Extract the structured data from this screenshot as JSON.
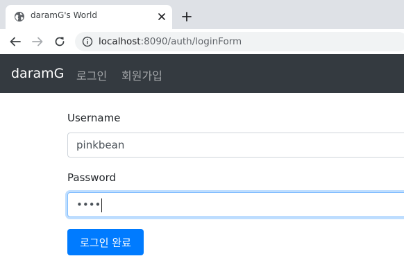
{
  "browser": {
    "tab_title": "daramG's World",
    "url_host": "localhost",
    "url_path": ":8090/auth/loginForm",
    "icons": {
      "favicon": "globe-icon",
      "close": "close-icon",
      "new_tab": "plus-icon",
      "back": "arrow-left-icon",
      "forward": "arrow-right-icon",
      "reload": "reload-icon",
      "site_info": "info-icon"
    }
  },
  "navbar": {
    "brand": "daramG",
    "links": [
      "로그인",
      "회원가입"
    ],
    "background": "#343a40"
  },
  "form": {
    "username_label": "Username",
    "username_value": "pinkbean",
    "password_label": "Password",
    "password_masked": "••••",
    "submit_label": "로그인 완료",
    "accent": "#007bff"
  }
}
